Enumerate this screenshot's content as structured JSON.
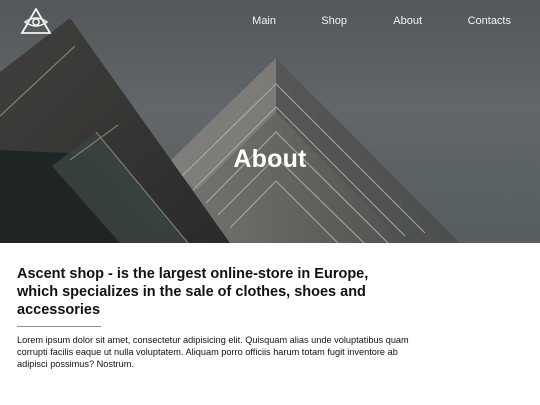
{
  "nav": {
    "items": [
      {
        "label": "Main"
      },
      {
        "label": "Shop"
      },
      {
        "label": "About"
      },
      {
        "label": "Contacts"
      }
    ]
  },
  "hero": {
    "title": "About"
  },
  "content": {
    "headline": "Ascent shop - is the largest online-store in Europe, which specializes in the sale of clothes, shoes and accessories",
    "body": "Lorem ipsum dolor sit amet, consectetur adipisicing elit. Quisquam alias unde voluptatibus quam corrupti facilis eaque ut nulla voluptatem. Aliquam porro officiis harum totam fugit inventore ab adipisci possimus? Nostrum."
  },
  "colors": {
    "hero_sky": "#6f7477",
    "text_dark": "#111111",
    "nav_text": "#f2f2f2",
    "divider": "#8d8d8d"
  },
  "icons": {
    "logo": "eye-triangle-logo"
  }
}
